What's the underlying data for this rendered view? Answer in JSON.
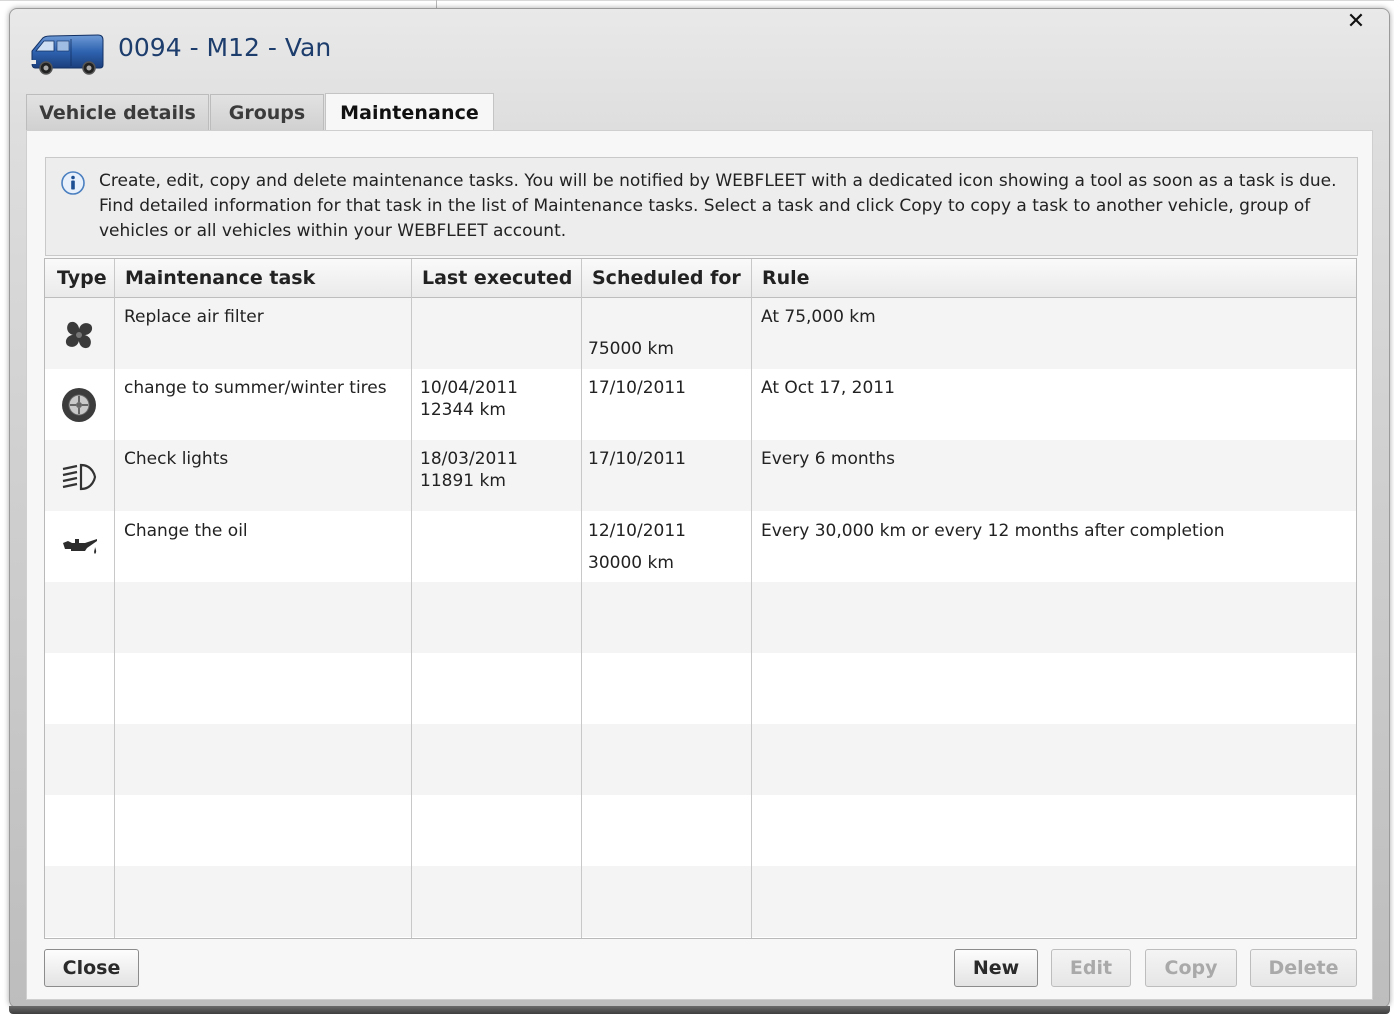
{
  "dialog": {
    "title": "0094 - M12 - Van",
    "close_glyph": "✕"
  },
  "tabs": [
    {
      "label": "Vehicle details",
      "active": false
    },
    {
      "label": "Groups",
      "active": false
    },
    {
      "label": "Maintenance",
      "active": true
    }
  ],
  "info": {
    "icon": "info-icon",
    "text": "Create, edit, copy and delete maintenance tasks. You will be notified by WEBFLEET with a dedicated icon showing a tool as soon as a task is due. Find detailed information for that task in the list of Maintenance tasks. Select a task and click Copy to copy a task to another vehicle, group of vehicles or all vehicles within your WEBFLEET account."
  },
  "table": {
    "columns": [
      "Type",
      "Maintenance task",
      "Last executed",
      "Scheduled for",
      "Rule"
    ],
    "rows": [
      {
        "type_icon": "fan-icon",
        "task": "Replace air filter",
        "last_date": "",
        "last_km": "",
        "sched_date": "",
        "sched_km": "75000 km",
        "rule": "At 75,000 km"
      },
      {
        "type_icon": "tire-icon",
        "task": "change to summer/winter tires",
        "last_date": "10/04/2011",
        "last_km": "12344 km",
        "sched_date": "17/10/2011",
        "sched_km": "",
        "rule": "At Oct 17, 2011"
      },
      {
        "type_icon": "headlight-icon",
        "task": "Check lights",
        "last_date": "18/03/2011",
        "last_km": "11891 km",
        "sched_date": "17/10/2011",
        "sched_km": "",
        "rule": "Every 6 months"
      },
      {
        "type_icon": "oil-can-icon",
        "task": "Change the oil",
        "last_date": "",
        "last_km": "",
        "sched_date": "12/10/2011",
        "sched_km": "30000 km",
        "rule": "Every 30,000 km or every 12 months after completion"
      }
    ]
  },
  "buttons": {
    "close": "Close",
    "new": "New",
    "edit": "Edit",
    "copy": "Copy",
    "delete": "Delete"
  }
}
